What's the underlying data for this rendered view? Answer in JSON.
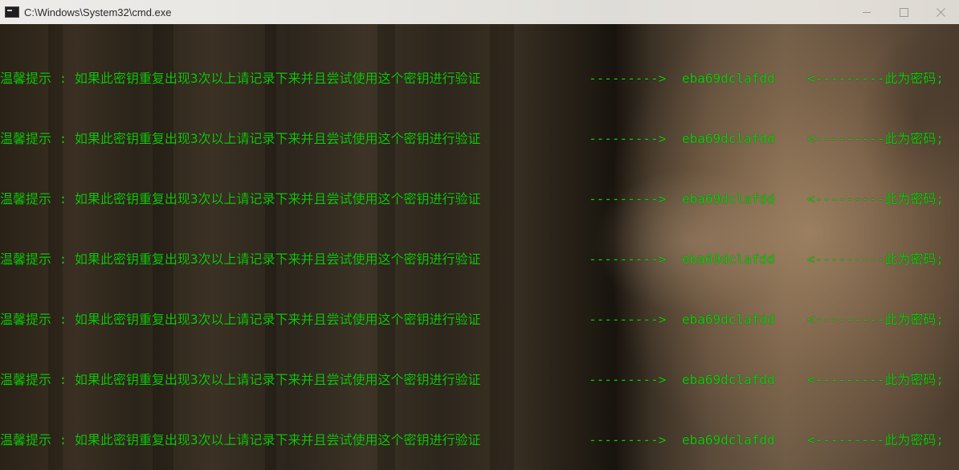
{
  "window": {
    "title": "C:\\Windows\\System32\\cmd.exe",
    "icon": "cmd-console-icon",
    "controls": {
      "minimize_icon": "minimize-icon",
      "maximize_icon": "maximize-icon",
      "close_icon": "close-icon"
    }
  },
  "console": {
    "text_color": "#16c60c",
    "lines": [
      {
        "message": "温馨提示 : 如果此密钥重复出现3次以上请记录下来并且尝试使用这个密钥进行验证",
        "arrow": "--------->",
        "key": "eba69dclafdd",
        "tail": "<---------此为密码;"
      },
      {
        "message": "温馨提示 : 如果此密钥重复出现3次以上请记录下来并且尝试使用这个密钥进行验证",
        "arrow": "--------->",
        "key": "eba69dclafdd",
        "tail": "<---------此为密码;"
      },
      {
        "message": "温馨提示 : 如果此密钥重复出现3次以上请记录下来并且尝试使用这个密钥进行验证",
        "arrow": "--------->",
        "key": "eba69dclafdd",
        "tail": "<---------此为密码;"
      },
      {
        "message": "温馨提示 : 如果此密钥重复出现3次以上请记录下来并且尝试使用这个密钥进行验证",
        "arrow": "--------->",
        "key": "eba69dclafdd",
        "tail": "<---------此为密码;"
      },
      {
        "message": "温馨提示 : 如果此密钥重复出现3次以上请记录下来并且尝试使用这个密钥进行验证",
        "arrow": "--------->",
        "key": "eba69dclafdd",
        "tail": "<---------此为密码;"
      },
      {
        "message": "温馨提示 : 如果此密钥重复出现3次以上请记录下来并且尝试使用这个密钥进行验证",
        "arrow": "--------->",
        "key": "eba69dclafdd",
        "tail": "<---------此为密码;"
      },
      {
        "message": "温馨提示 : 如果此密钥重复出现3次以上请记录下来并且尝试使用这个密钥进行验证",
        "arrow": "--------->",
        "key": "eba69dclafdd",
        "tail": "<---------此为密码;"
      }
    ]
  }
}
